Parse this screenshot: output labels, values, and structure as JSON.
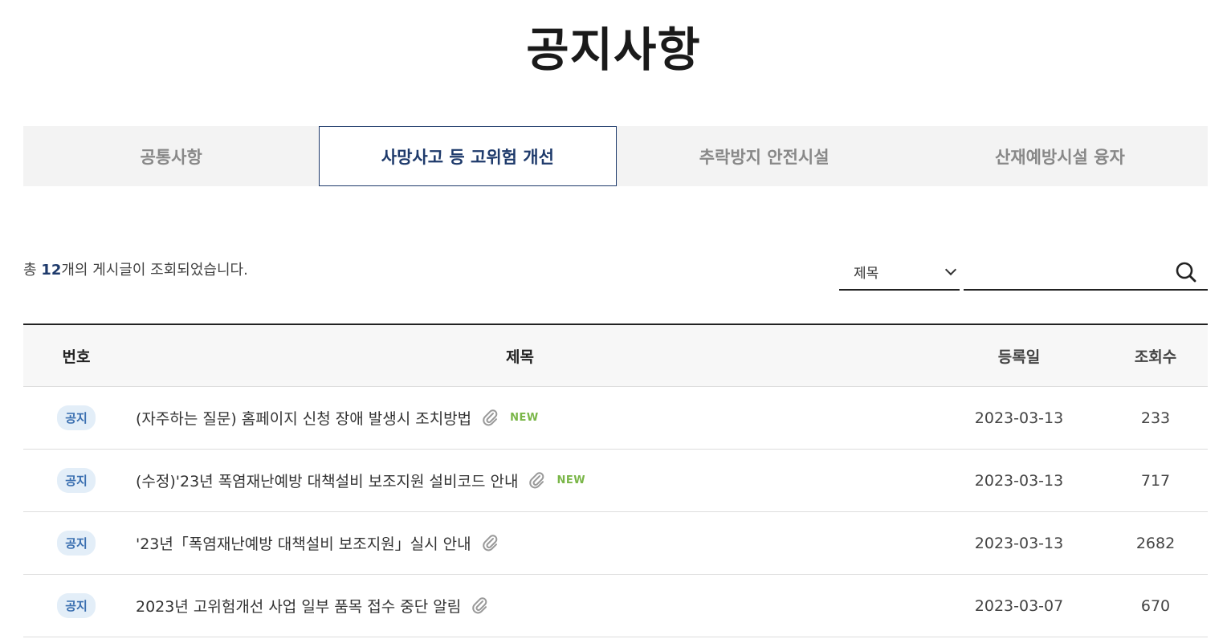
{
  "page_title": "공지사항",
  "tabs": [
    {
      "label": "공통사항"
    },
    {
      "label": "사망사고 등 고위험 개선"
    },
    {
      "label": "추락방지 안전시설"
    },
    {
      "label": "산재예방시설 융자"
    }
  ],
  "summary": {
    "prefix": "총 ",
    "count": "12",
    "suffix": "개의 게시글이 조회되었습니다."
  },
  "search": {
    "field_selected": "제목",
    "input_value": "",
    "search_icon": "search-icon"
  },
  "table": {
    "headers": {
      "no": "번호",
      "title": "제목",
      "date": "등록일",
      "views": "조회수"
    },
    "rows": [
      {
        "badge": "공지",
        "title": "(자주하는 질문) 홈페이지 신청 장애 발생시 조치방법",
        "new": "NEW",
        "date": "2023-03-13",
        "views": "233"
      },
      {
        "badge": "공지",
        "title": "(수정)'23년 폭염재난예방 대책설비 보조지원 설비코드 안내",
        "new": "NEW",
        "date": "2023-03-13",
        "views": "717"
      },
      {
        "badge": "공지",
        "title": "'23년「폭염재난예방 대책설비 보조지원」실시 안내",
        "date": "2023-03-13",
        "views": "2682"
      },
      {
        "badge": "공지",
        "title": "2023년 고위험개선 사업 일부 품목 접수 중단 알림",
        "date": "2023-03-07",
        "views": "670"
      }
    ]
  },
  "colors": {
    "accent": "#1e3a6b",
    "badge_bg": "#e3eef8",
    "badge_text": "#3a6fb0",
    "new": "#7ab648"
  }
}
